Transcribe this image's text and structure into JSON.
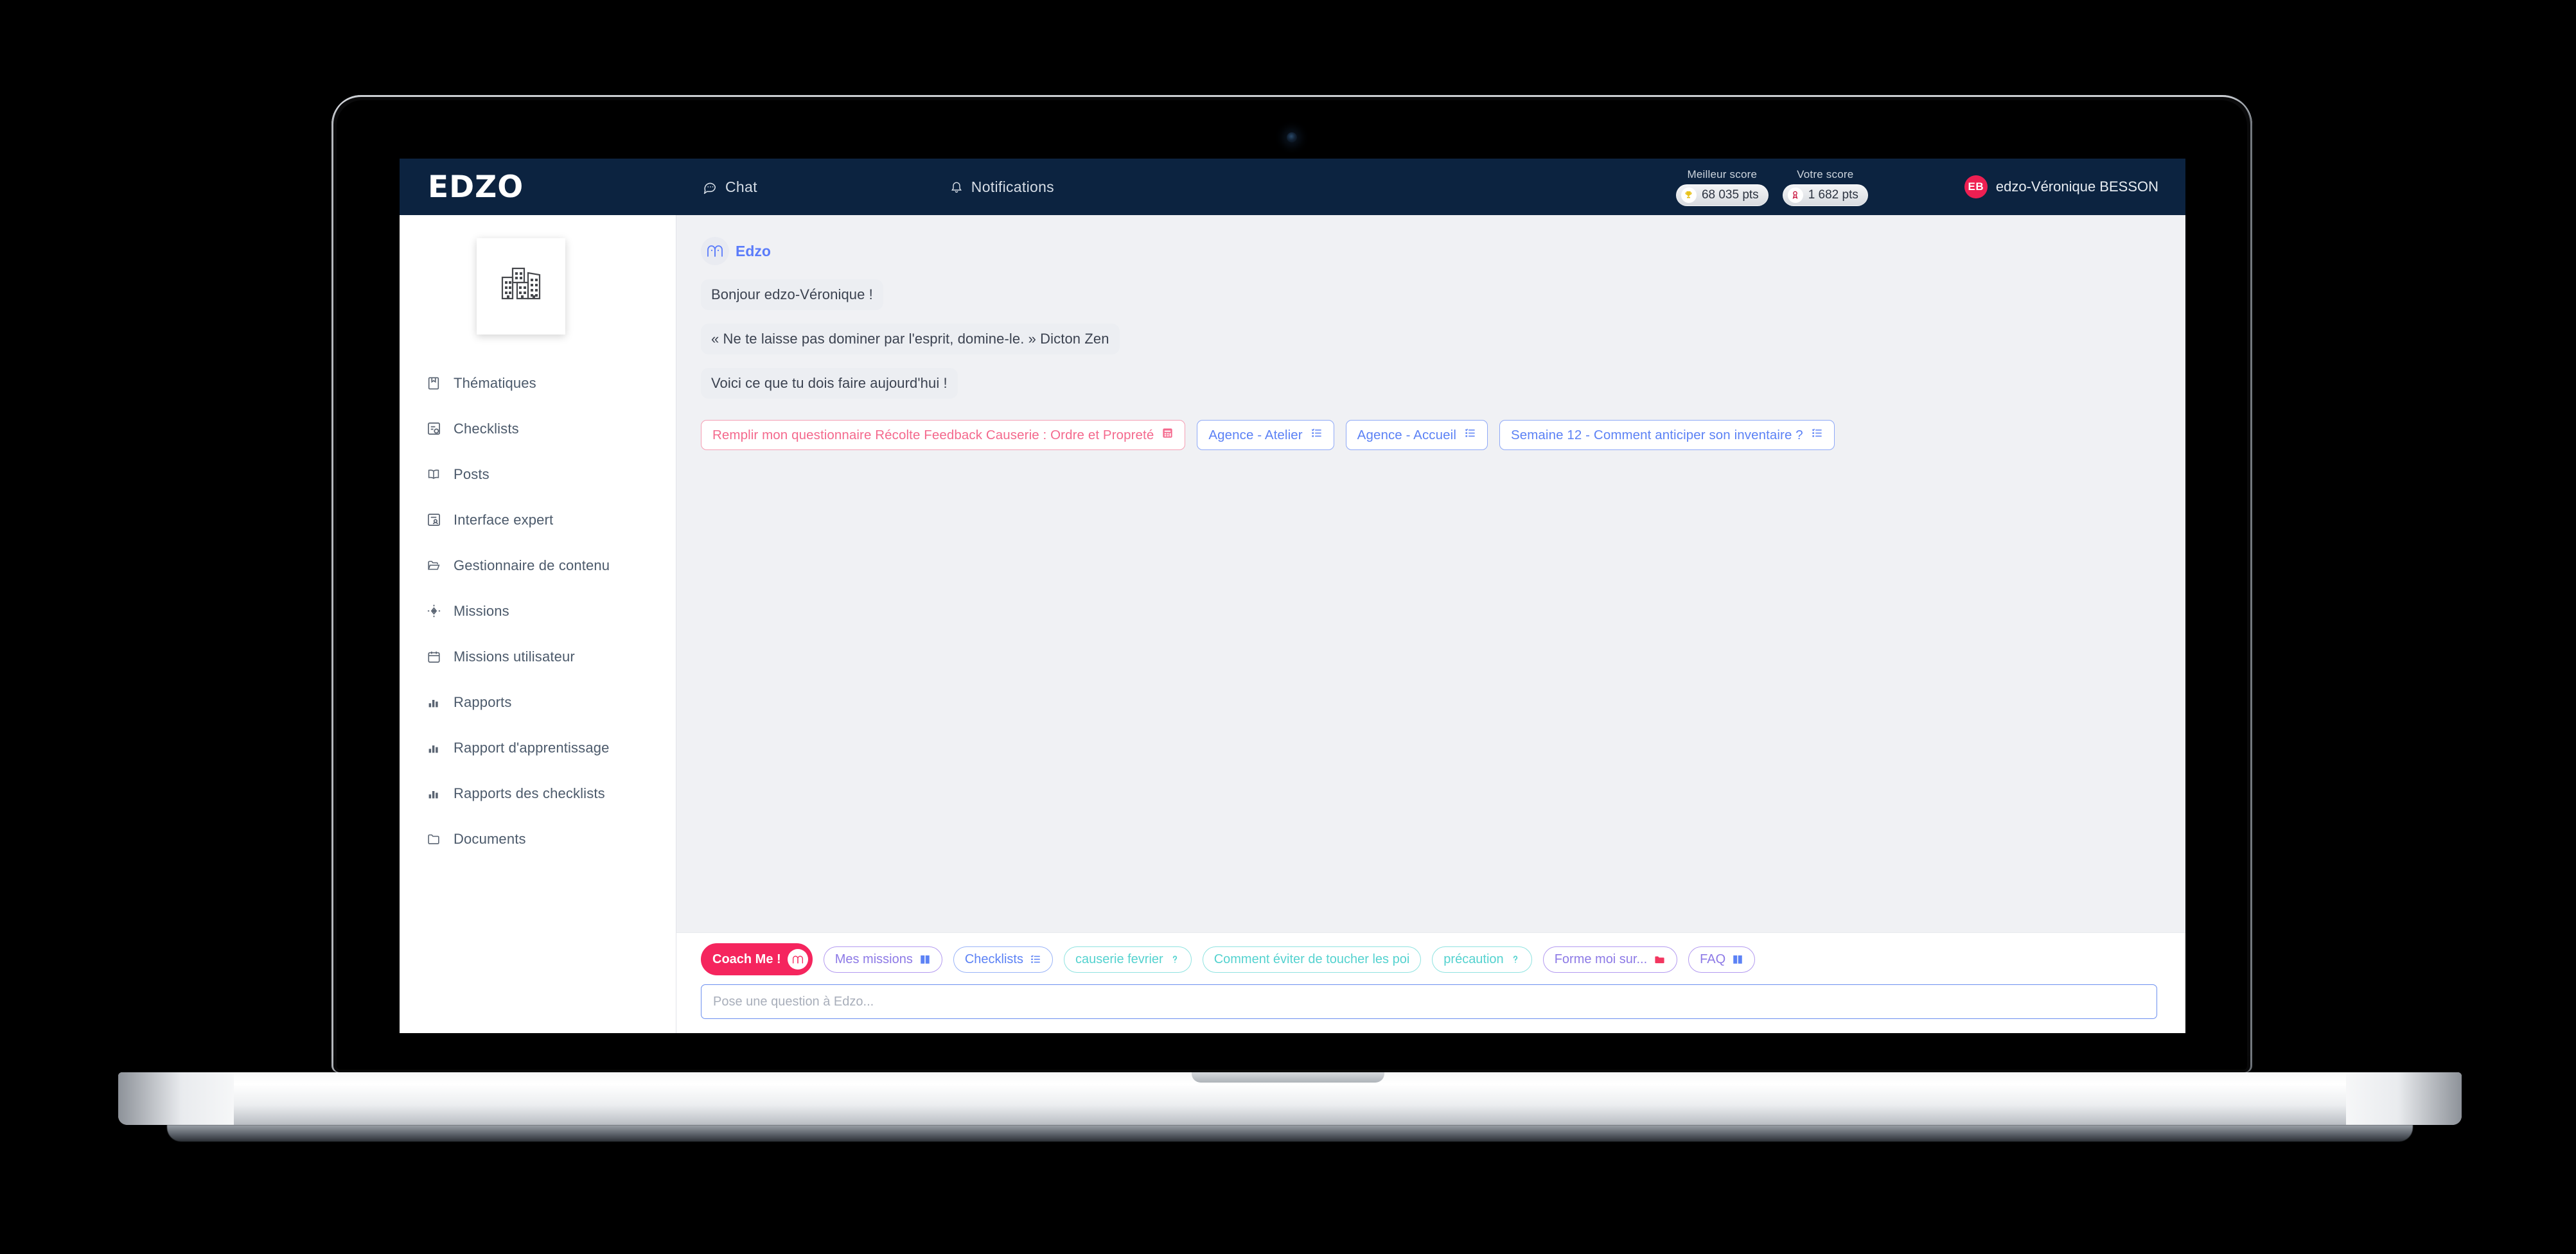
{
  "brand": {
    "name": "EDZO"
  },
  "topnav": [
    {
      "label": "Chat",
      "icon": "chat-bubble-icon"
    },
    {
      "label": "Notifications",
      "icon": "bell-icon"
    }
  ],
  "scores": {
    "best": {
      "label": "Meilleur score",
      "value": "68 035 pts",
      "icon": "trophy-icon",
      "icon_glyph": "🏆",
      "color": "#e8c21b"
    },
    "yours": {
      "label": "Votre score",
      "value": "1 682 pts",
      "icon": "medal-icon",
      "icon_glyph": "🎖",
      "color": "#c9173f"
    }
  },
  "user": {
    "initials": "EB",
    "name": "edzo-Véronique BESSON",
    "avatar_color": "#ee1f52"
  },
  "sidebar": {
    "org_logo_icon": "buildings-icon",
    "items": [
      {
        "label": "Thématiques",
        "icon": "page-icon"
      },
      {
        "label": "Checklists",
        "icon": "checklist-box-icon"
      },
      {
        "label": "Posts",
        "icon": "open-book-icon"
      },
      {
        "label": "Interface expert",
        "icon": "person-box-icon"
      },
      {
        "label": "Gestionnaire de contenu",
        "icon": "folder-open-icon"
      },
      {
        "label": "Missions",
        "icon": "target-icon"
      },
      {
        "label": "Missions utilisateur",
        "icon": "calendar-icon"
      },
      {
        "label": "Rapports",
        "icon": "bar-chart-icon"
      },
      {
        "label": "Rapport d'apprentissage",
        "icon": "bar-chart-icon"
      },
      {
        "label": "Rapports des checklists",
        "icon": "bar-chart-icon"
      },
      {
        "label": "Documents",
        "icon": "folder-icon"
      }
    ]
  },
  "chat": {
    "bot_name": "Edzo",
    "bot_avatar_icon": "edzo-logo-icon",
    "messages": [
      "Bonjour edzo-Véronique !",
      "« Ne te laisse pas dominer par l'esprit, domine-le. » Dicton Zen",
      "Voici ce que tu dois faire aujourd'hui !"
    ],
    "task_chips": [
      {
        "label": "Remplir mon questionnaire Récolte Feedback Causerie : Ordre et Propreté",
        "style": "pink",
        "icon": "form-icon"
      },
      {
        "label": "Agence - Atelier",
        "style": "blue",
        "icon": "checklist-icon"
      },
      {
        "label": "Agence - Accueil",
        "style": "blue",
        "icon": "checklist-icon"
      },
      {
        "label": "Semaine 12 - Comment anticiper son inventaire ?",
        "style": "blue",
        "icon": "checklist-icon"
      }
    ]
  },
  "quick_actions": [
    {
      "label": "Coach Me !",
      "style": "solid-pink",
      "icon": "edzo-logo-icon"
    },
    {
      "label": "Mes missions",
      "style": "purple",
      "icon": "book-icon"
    },
    {
      "label": "Checklists",
      "style": "blue",
      "icon": "checklist-icon"
    },
    {
      "label": "causerie fevrier",
      "style": "teal",
      "icon": "question-icon"
    },
    {
      "label": "Comment éviter de toucher les poi",
      "style": "teal",
      "icon": "none"
    },
    {
      "label": "précaution",
      "style": "teal",
      "icon": "question-icon"
    },
    {
      "label": "Forme moi sur...",
      "style": "purple",
      "icon": "folder-red-icon"
    },
    {
      "label": "FAQ",
      "style": "purple",
      "icon": "book-icon"
    }
  ],
  "composer": {
    "placeholder": "Pose une question à Edzo...",
    "value": ""
  },
  "colors": {
    "header_navy": "#0c2340",
    "accent_pink": "#f5255e",
    "accent_blue": "#5c82f5",
    "content_bg": "#f0f1f4"
  }
}
